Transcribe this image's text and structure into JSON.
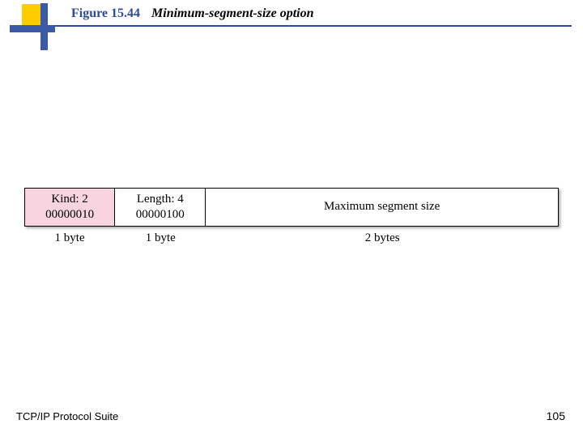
{
  "figure": {
    "number": "Figure 15.44",
    "title": "Minimum-segment-size option"
  },
  "diagram": {
    "cells": {
      "kind": {
        "label": "Kind: 2",
        "bits": "00000010",
        "caption": "1 byte"
      },
      "length": {
        "label": "Length: 4",
        "bits": "00000100",
        "caption": "1 byte"
      },
      "mss": {
        "label": "Maximum segment size",
        "caption": "2 bytes"
      }
    }
  },
  "footer": {
    "left": "TCP/IP Protocol Suite",
    "page": "105"
  }
}
